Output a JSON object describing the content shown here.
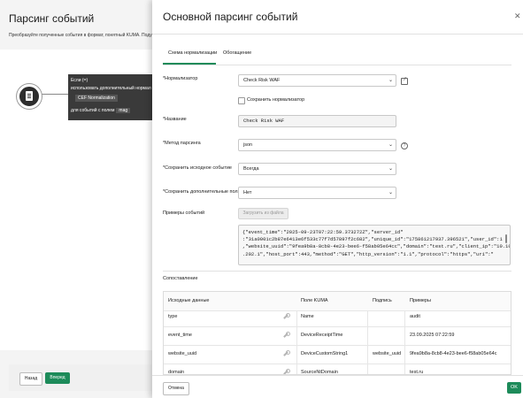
{
  "background": {
    "title": "Парсинг событий",
    "description": "Преобразуйте полученные события в формат, понятный KUMA. Поду",
    "rule_card": {
      "line1": "Если (=)",
      "line2": "использовать дополнительный нормал",
      "tag": "CEF Normalization",
      "line4_prefix": "для событий с полем",
      "line4_value": "mag"
    },
    "back_label": "Назад",
    "next_label": "Вперед"
  },
  "panel": {
    "title": "Основной парсинг событий",
    "tabs": [
      {
        "label": "Схема нормализации",
        "active": true
      },
      {
        "label": "Обогащение",
        "active": false
      }
    ],
    "normalizer": {
      "label": "*Нормализатор",
      "value": "Check Risk WAF"
    },
    "save_normalizer_label": "Сохранить нормализатор",
    "name": {
      "label": "*Название",
      "value": "Check Risk WAF"
    },
    "parsing_method": {
      "label": "*Метод парсинга",
      "value": "json"
    },
    "keep_raw": {
      "label": "*Сохранить исходное событие",
      "value": "Всегда"
    },
    "keep_extra": {
      "label": "*Сохранить дополнительные поля",
      "value": "Нет"
    },
    "examples": {
      "label": "Примеры событий",
      "upload_label": "Загрузить из файла",
      "lines": [
        "{\"event_time\":\"2025-09-23T07:22:59.373272Z\",\"server_id\"",
        ":\"31a0001c2b87e6413e6f533c77f7d57897f2c682\",\"unique_id\":\"175861217937.396521\",\"user_id\":1",
        ",\"website_uuid\":\"9fea9b8a-8cb8-4e23-bee6-f58ab05e64cc\",\"domain\":\"test.ru\",\"client_ip\":\"10.10",
        ".202.1\",\"host_port\":443,\"method\":\"GET\",\"http_version\":\"1.1\",\"protocol\":\"https\",\"uri\":\""
      ]
    },
    "mapping": {
      "label": "Сопоставление",
      "columns": [
        "Исходные данные",
        "Поле KUMA",
        "Подпись",
        "Примеры"
      ],
      "rows": [
        {
          "source": "type",
          "kuma": "Name",
          "label": "",
          "example": "audit"
        },
        {
          "source": "event_time",
          "kuma": "DeviceReceiptTime",
          "label": "",
          "example": "23.09.2025 07:22:59"
        },
        {
          "source": "website_uuid",
          "kuma": "DeviceCustomString1",
          "label": "website_uuid",
          "example": "9fea9b8a-8cb8-4e23-bee6-f58ab05e64c"
        },
        {
          "source": "domain",
          "kuma": "SourceNtDomain",
          "label": "",
          "example": "test.ru"
        }
      ]
    },
    "cancel_label": "Отмена",
    "ok_label": "OK"
  },
  "colors": {
    "accent": "#1d8b5a",
    "rule_card": "#3a3a3a"
  }
}
